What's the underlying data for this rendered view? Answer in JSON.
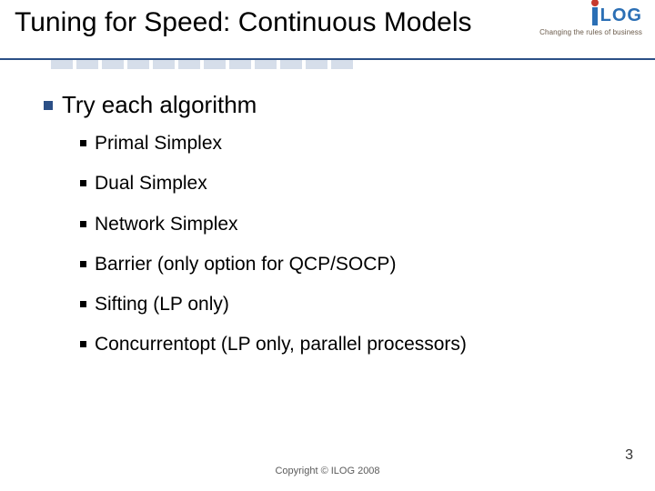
{
  "title": "Tuning for Speed: Continuous Models",
  "logo": {
    "text": "LOG",
    "tagline": "Changing the rules of business"
  },
  "heading": "Try each algorithm",
  "items": [
    "Primal Simplex",
    "Dual Simplex",
    "Network Simplex",
    "Barrier (only option for QCP/SOCP)",
    "Sifting (LP only)",
    "Concurrentopt (LP only, parallel processors)"
  ],
  "footer": "Copyright © ILOG 2008",
  "page": "3"
}
